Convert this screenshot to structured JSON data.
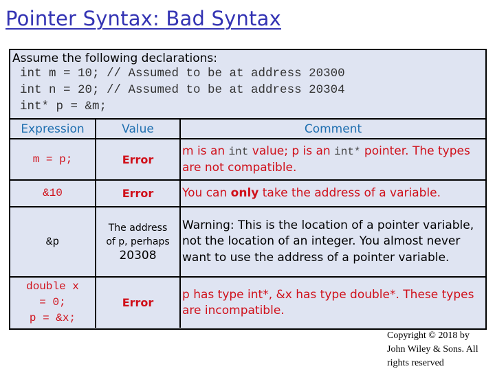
{
  "title": "Pointer Syntax: Bad Syntax",
  "declarations": {
    "intro": "Assume the following declarations:",
    "lines": [
      "int m = 10; // Assumed to be at address 20300",
      "int n = 20; // Assumed to be at address 20304",
      "int* p = &m;"
    ]
  },
  "table": {
    "headers": [
      "Expression",
      "Value",
      "Comment"
    ],
    "rows": [
      {
        "expression": "m = p;",
        "value": "Error",
        "comment": {
          "t1": "m is an ",
          "code1": "int",
          "t2": " value; p is an ",
          "code2": "int*",
          "t3": " pointer. The types are not compatible."
        }
      },
      {
        "expression": "&10",
        "value": "Error",
        "comment": {
          "t1": "You can ",
          "bold": "only",
          "t2": " take the address of a variable."
        }
      },
      {
        "expression": "&p",
        "value": {
          "line1": "The address",
          "line2": "of p, perhaps",
          "line3": "20308"
        },
        "comment": "Warning: This is the location of a pointer variable, not the location of an integer.  You almost never want to use the address of a pointer variable."
      },
      {
        "expression": {
          "line1": "double x",
          "line2": "= 0;",
          "line3": "p = &x;"
        },
        "value": "Error",
        "comment": "p has type int*, &x has type double*. These types are incompatible."
      }
    ]
  },
  "copyright": {
    "line1": "Copyright © 2018 by",
    "line2": "John Wiley & Sons. All",
    "line3": "rights reserved"
  },
  "colors": {
    "title": "#3333b3",
    "header_text": "#1f6fb0",
    "error_text": "#d0101a",
    "box_background": "#dfe4f2"
  }
}
